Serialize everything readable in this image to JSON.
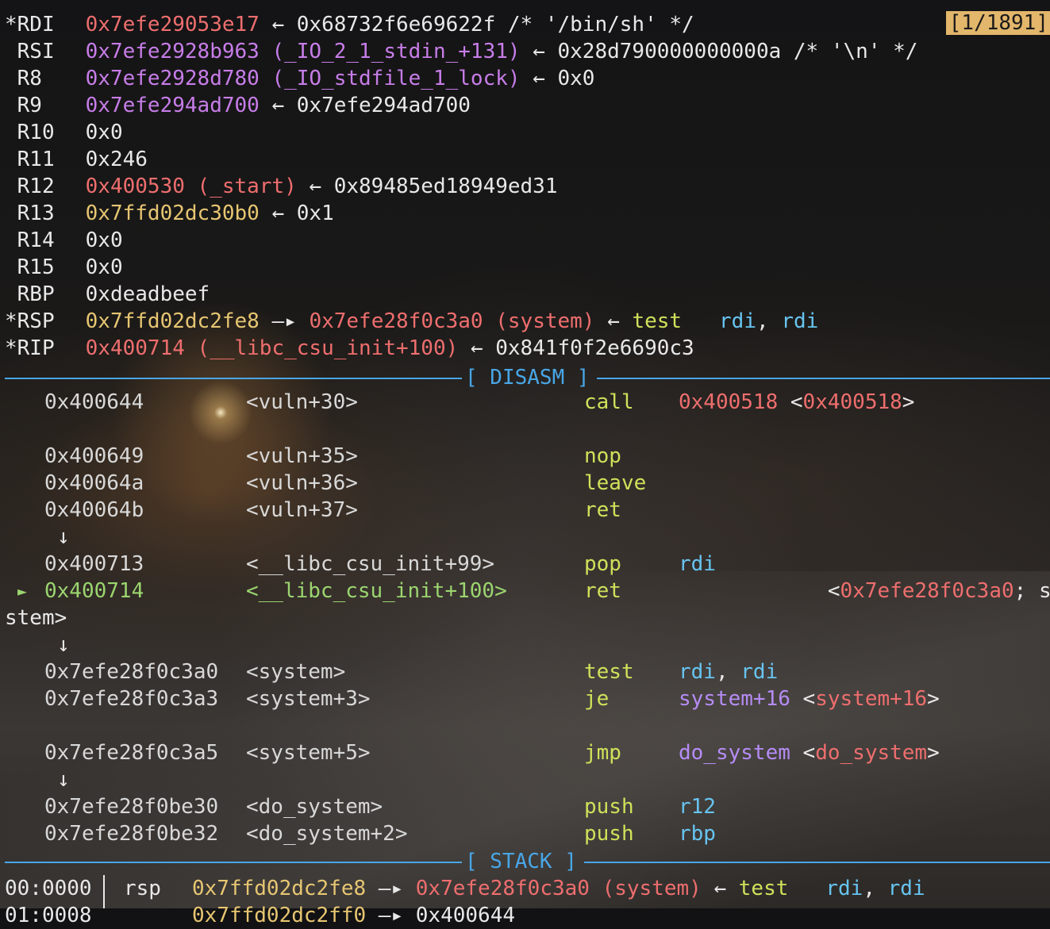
{
  "counter": "[1/1891]",
  "registers": [
    {
      "star": "*",
      "name": "RDI",
      "parts": [
        {
          "t": "0x7efe29053e17",
          "c": "red"
        },
        {
          "t": " ← 0x68732f6e69622f /* '/bin/sh' */",
          "c": "w"
        }
      ]
    },
    {
      "star": " ",
      "name": "RSI",
      "parts": [
        {
          "t": "0x7efe2928b963 (_IO_2_1_stdin_+131)",
          "c": "pur"
        },
        {
          "t": " ← 0x28d790000000000a /* '\\n' */",
          "c": "w"
        }
      ]
    },
    {
      "star": " ",
      "name": "R8",
      "parts": [
        {
          "t": "0x7efe2928d780 (_IO_stdfile_1_lock)",
          "c": "pur"
        },
        {
          "t": " ← 0x0",
          "c": "w"
        }
      ]
    },
    {
      "star": " ",
      "name": "R9",
      "parts": [
        {
          "t": "0x7efe294ad700",
          "c": "pur"
        },
        {
          "t": " ← 0x7efe294ad700",
          "c": "w"
        }
      ]
    },
    {
      "star": " ",
      "name": "R10",
      "parts": [
        {
          "t": "0x0",
          "c": "w"
        }
      ]
    },
    {
      "star": " ",
      "name": "R11",
      "parts": [
        {
          "t": "0x246",
          "c": "w"
        }
      ]
    },
    {
      "star": " ",
      "name": "R12",
      "parts": [
        {
          "t": "0x400530 (_start)",
          "c": "red"
        },
        {
          "t": " ← 0x89485ed18949ed31",
          "c": "w"
        }
      ]
    },
    {
      "star": " ",
      "name": "R13",
      "parts": [
        {
          "t": "0x7ffd02dc30b0",
          "c": "yel"
        },
        {
          "t": " ← 0x1",
          "c": "w"
        }
      ]
    },
    {
      "star": " ",
      "name": "R14",
      "parts": [
        {
          "t": "0x0",
          "c": "w"
        }
      ]
    },
    {
      "star": " ",
      "name": "R15",
      "parts": [
        {
          "t": "0x0",
          "c": "w"
        }
      ]
    },
    {
      "star": " ",
      "name": "RBP",
      "parts": [
        {
          "t": "0xdeadbeef",
          "c": "w"
        }
      ]
    },
    {
      "star": "*",
      "name": "RSP",
      "parts": [
        {
          "t": "0x7ffd02dc2fe8",
          "c": "yel"
        },
        {
          "t": " —▸ ",
          "c": "w"
        },
        {
          "t": "0x7efe28f0c3a0 (system)",
          "c": "red"
        },
        {
          "t": " ← ",
          "c": "w"
        },
        {
          "t": "test",
          "c": "lime"
        },
        {
          "t": "   ",
          "c": "w"
        },
        {
          "t": "rdi",
          "c": "cyan"
        },
        {
          "t": ", ",
          "c": "w"
        },
        {
          "t": "rdi",
          "c": "cyan"
        }
      ]
    },
    {
      "star": "*",
      "name": "RIP",
      "parts": [
        {
          "t": "0x400714 (__libc_csu_init+100)",
          "c": "red"
        },
        {
          "t": " ← 0x841f0f2e6690c3",
          "c": "w"
        }
      ]
    }
  ],
  "disasm_title": "[ DISASM ]",
  "stack_title": "[ STACK ]",
  "disasm": [
    {
      "kind": "ins",
      "addr": "0x400644",
      "sym": "<vuln+30>",
      "mn": "call",
      "op": [
        {
          "t": "0x400518",
          "c": "red"
        },
        {
          "t": " <",
          "c": "w"
        },
        {
          "t": "0x400518",
          "c": "red"
        },
        {
          "t": ">",
          "c": "w"
        }
      ]
    },
    {
      "kind": "blank"
    },
    {
      "kind": "ins",
      "addr": "0x400649",
      "sym": "<vuln+35>",
      "mn": "nop",
      "op": []
    },
    {
      "kind": "ins",
      "addr": "0x40064a",
      "sym": "<vuln+36>",
      "mn": "leave",
      "op": []
    },
    {
      "kind": "ins",
      "addr": "0x40064b",
      "sym": "<vuln+37>",
      "mn": "ret",
      "op": []
    },
    {
      "kind": "arrow",
      "t": "↓"
    },
    {
      "kind": "ins",
      "addr": "0x400713",
      "sym": "<__libc_csu_init+99>",
      "mn": "pop",
      "op": [
        {
          "t": "rdi",
          "c": "cyan"
        }
      ]
    },
    {
      "kind": "cur",
      "addr": "0x400714",
      "sym": "<__libc_csu_init+100>",
      "mn": "ret",
      "op": [
        {
          "t": "            <",
          "c": "w"
        },
        {
          "t": "0x7efe28f0c3a0",
          "c": "red"
        },
        {
          "t": "; sy",
          "c": "w"
        }
      ]
    },
    {
      "kind": "wrap",
      "t": "stem>"
    },
    {
      "kind": "arrow",
      "t": "↓"
    },
    {
      "kind": "ins",
      "addr": "0x7efe28f0c3a0",
      "sym": "<system>",
      "mn": "test",
      "op": [
        {
          "t": "rdi",
          "c": "cyan"
        },
        {
          "t": ", ",
          "c": "w"
        },
        {
          "t": "rdi",
          "c": "cyan"
        }
      ]
    },
    {
      "kind": "ins",
      "addr": "0x7efe28f0c3a3",
      "sym": "<system+3>",
      "mn": "je",
      "op": [
        {
          "t": "system+16",
          "c": "vio"
        },
        {
          "t": " <",
          "c": "w"
        },
        {
          "t": "system+16",
          "c": "red"
        },
        {
          "t": ">",
          "c": "w"
        }
      ]
    },
    {
      "kind": "blank"
    },
    {
      "kind": "ins",
      "addr": "0x7efe28f0c3a5",
      "sym": "<system+5>",
      "mn": "jmp",
      "op": [
        {
          "t": "do_system",
          "c": "vio"
        },
        {
          "t": " <",
          "c": "w"
        },
        {
          "t": "do_system",
          "c": "red"
        },
        {
          "t": ">",
          "c": "w"
        }
      ]
    },
    {
      "kind": "arrow",
      "t": "↓"
    },
    {
      "kind": "ins",
      "addr": "0x7efe28f0be30",
      "sym": "<do_system>",
      "mn": "push",
      "op": [
        {
          "t": "r12",
          "c": "cyan"
        }
      ]
    },
    {
      "kind": "ins",
      "addr": "0x7efe28f0be32",
      "sym": "<do_system+2>",
      "mn": "push",
      "op": [
        {
          "t": "rbp",
          "c": "cyan"
        }
      ]
    }
  ],
  "stack": [
    {
      "idx": "00:0000",
      "reg": "rsp",
      "parts": [
        {
          "t": "0x7ffd02dc2fe8",
          "c": "yel"
        },
        {
          "t": " —▸ ",
          "c": "w"
        },
        {
          "t": "0x7efe28f0c3a0 (system)",
          "c": "red"
        },
        {
          "t": " ← ",
          "c": "w"
        },
        {
          "t": "test",
          "c": "lime"
        },
        {
          "t": "   ",
          "c": "w"
        },
        {
          "t": "rdi",
          "c": "cyan"
        },
        {
          "t": ", ",
          "c": "w"
        },
        {
          "t": "rdi",
          "c": "cyan"
        }
      ]
    },
    {
      "idx": "01:0008",
      "reg": "",
      "parts": [
        {
          "t": "0x7ffd02dc2ff0",
          "c": "yel"
        },
        {
          "t": " —▸ 0x400644",
          "c": "w"
        }
      ]
    }
  ]
}
